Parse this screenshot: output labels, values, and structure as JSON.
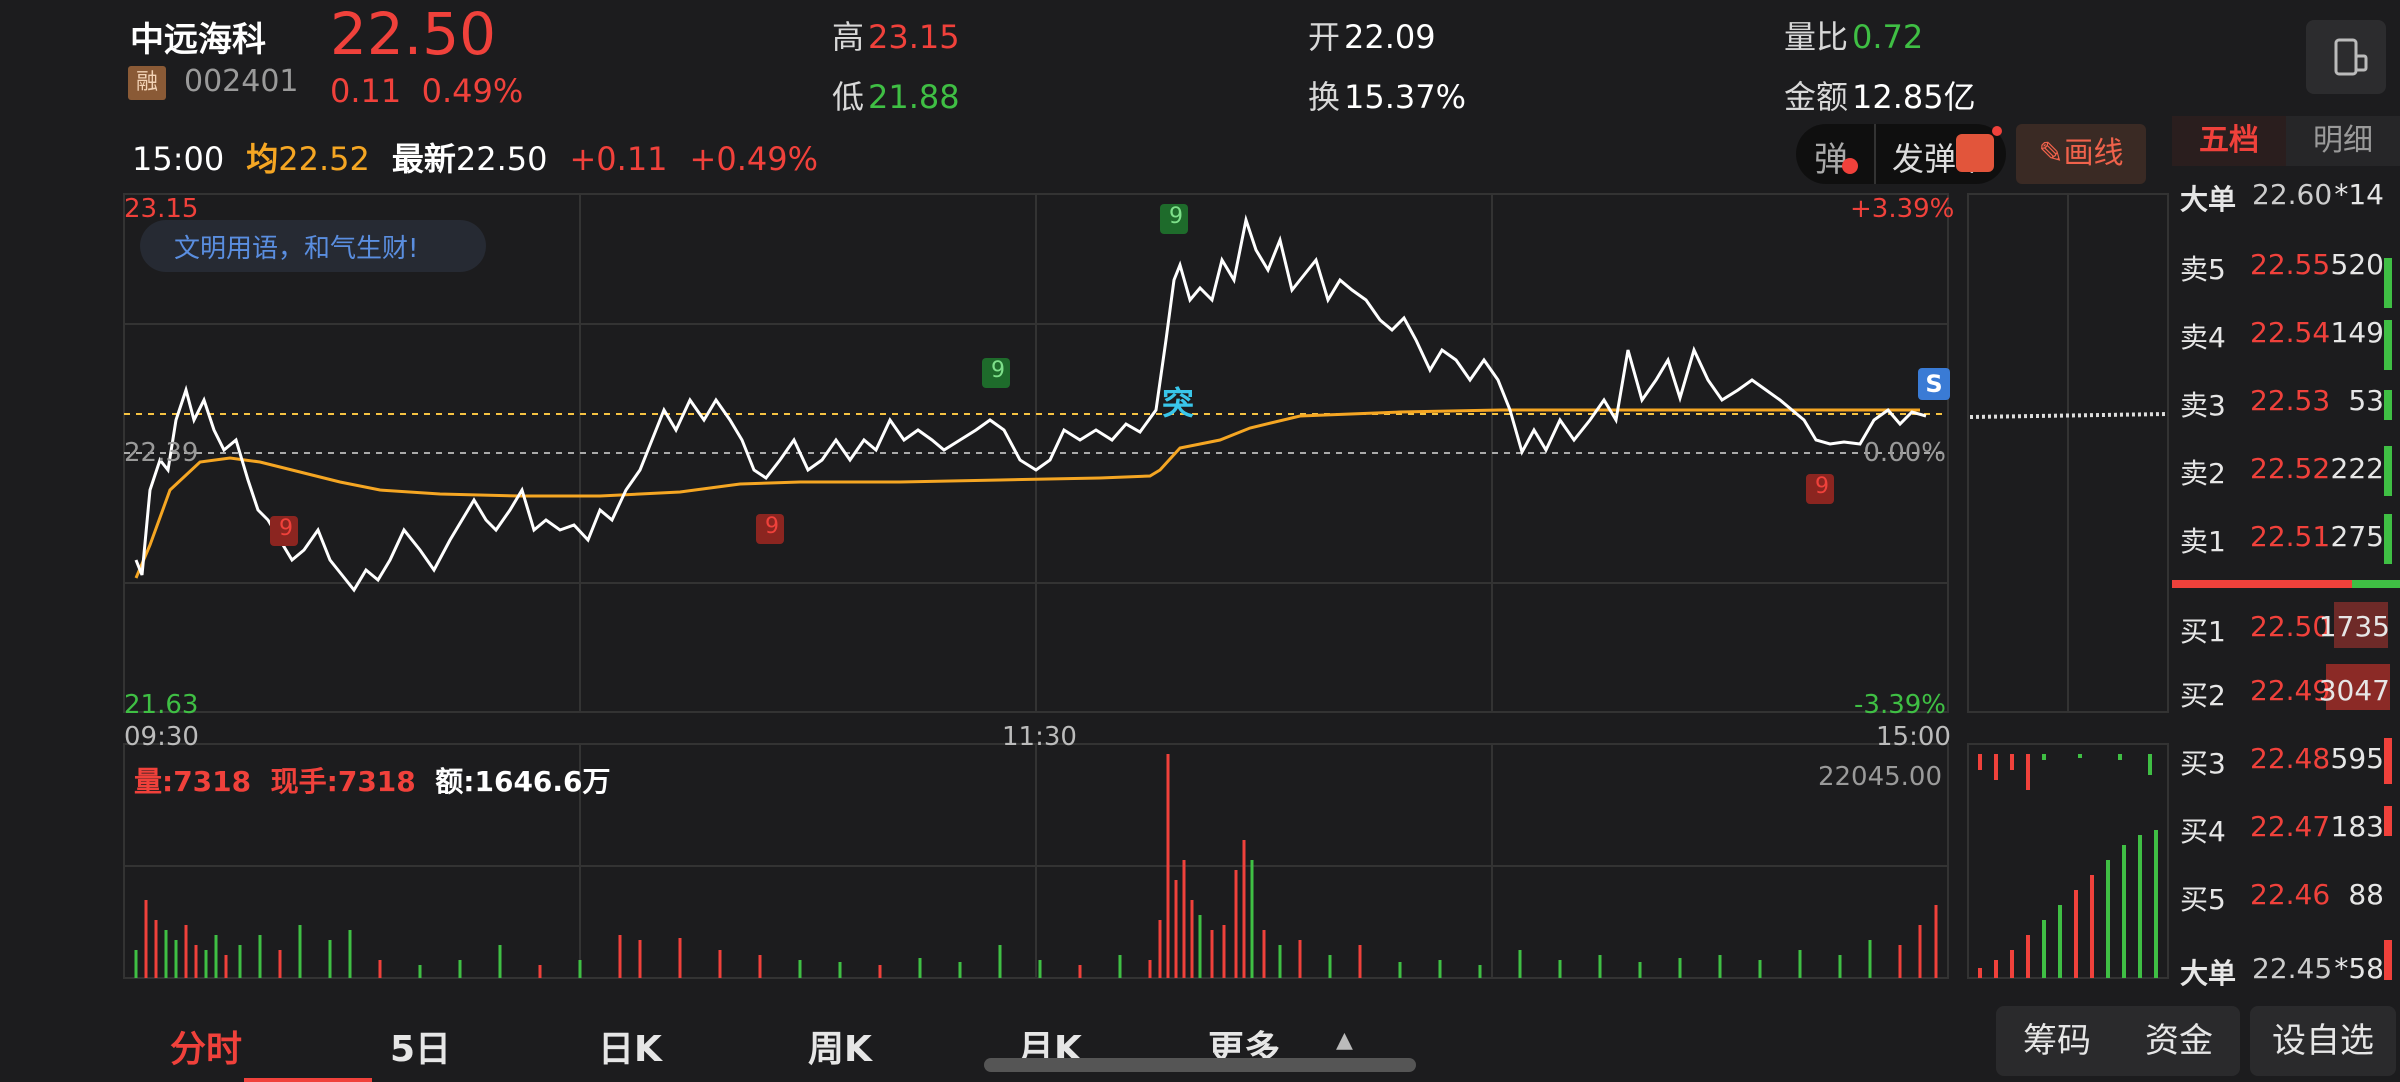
{
  "header": {
    "name": "中远海科",
    "price": "22.50",
    "tag": "融",
    "code": "002401",
    "change": "0.11",
    "change_pct": "0.49%",
    "high_label": "高",
    "high": "23.15",
    "low_label": "低",
    "low": "21.88",
    "open_label": "开",
    "open": "22.09",
    "turnover_label": "换",
    "turnover": "15.37%",
    "vol_ratio_label": "量比",
    "vol_ratio": "0.72",
    "amount_label": "金额",
    "amount": "12.85亿"
  },
  "infobar": {
    "time": "15:00",
    "avg_label": "均",
    "avg": "22.52",
    "latest_label": "最新",
    "latest": "22.50",
    "chg": "+0.11",
    "chg_pct": "+0.49%"
  },
  "toolbar": {
    "danmu_icon": "弹",
    "danmu_send": "发弹幕",
    "draw_line": "画线"
  },
  "chart": {
    "banner": "文明用语，和气生财!",
    "y_top": "23.15",
    "y_mid": "22.39",
    "y_bottom": "21.63",
    "pct_top": "+3.39%",
    "pct_mid": "0.00%",
    "pct_bottom": "-3.39%",
    "x_start": "09:30",
    "x_mid": "11:30",
    "x_end": "15:00",
    "marker_tu": "突",
    "marker_s": "S",
    "nine": "9",
    "vol_label": "量:7318",
    "hand_label": "现手:7318",
    "amt_label": "额:1646.6万",
    "vol_max": "22045.00"
  },
  "book": {
    "tab_five": "五档",
    "tab_detail": "明细",
    "big_sell": {
      "label": "大单",
      "price": "22.60",
      "vol": "*14"
    },
    "asks": [
      {
        "label": "卖5",
        "price": "22.55",
        "vol": "520"
      },
      {
        "label": "卖4",
        "price": "22.54",
        "vol": "149"
      },
      {
        "label": "卖3",
        "price": "22.53",
        "vol": "53"
      },
      {
        "label": "卖2",
        "price": "22.52",
        "vol": "222"
      },
      {
        "label": "卖1",
        "price": "22.51",
        "vol": "275"
      }
    ],
    "bids": [
      {
        "label": "买1",
        "price": "22.50",
        "vol": "1735"
      },
      {
        "label": "买2",
        "price": "22.49",
        "vol": "3047"
      },
      {
        "label": "买3",
        "price": "22.48",
        "vol": "595"
      },
      {
        "label": "买4",
        "price": "22.47",
        "vol": "183"
      },
      {
        "label": "买5",
        "price": "22.46",
        "vol": "88"
      }
    ],
    "big_buy": {
      "label": "大单",
      "price": "22.45",
      "vol": "*58"
    }
  },
  "nav": {
    "tabs": [
      "分时",
      "5日",
      "日K",
      "周K",
      "月K",
      "更多"
    ],
    "right_buttons": [
      "筹码",
      "资金",
      "设自选"
    ]
  },
  "colors": {
    "up": "#f0413b",
    "down": "#3fbf44",
    "avg_line": "#f5a623",
    "price_line": "#ffffff"
  }
}
